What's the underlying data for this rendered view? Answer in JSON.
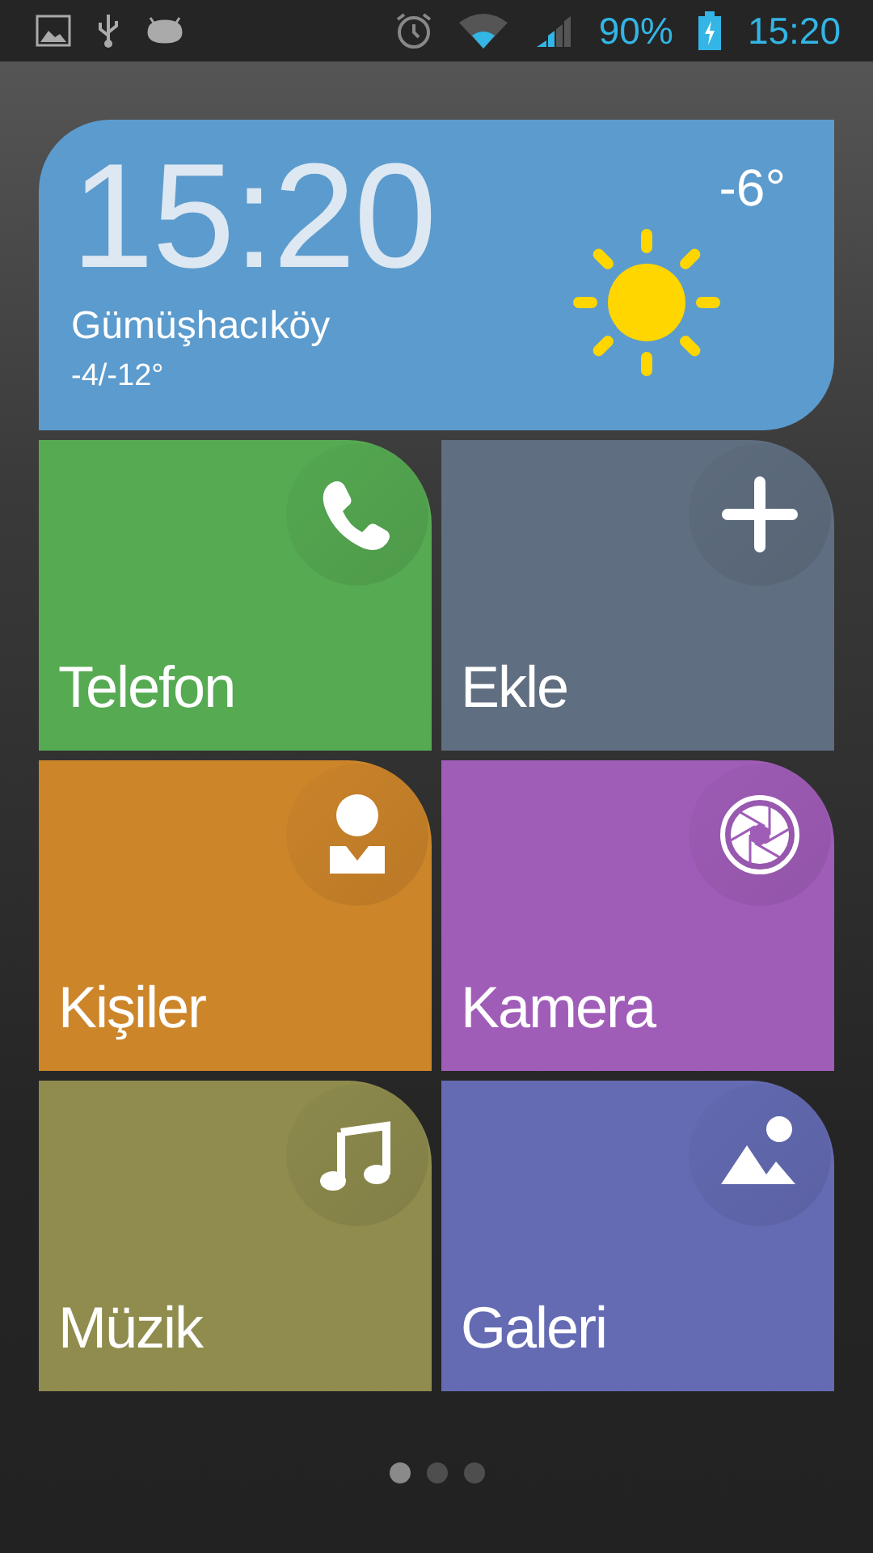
{
  "status_bar": {
    "battery": "90%",
    "time": "15:20"
  },
  "clock_widget": {
    "time": "15:20",
    "location": "Gümüşhacıköy",
    "range": "-4/-12°",
    "temperature": "-6°"
  },
  "tiles": [
    {
      "label": "Telefon",
      "kind": "phone",
      "color": "#56aa52"
    },
    {
      "label": "Ekle",
      "kind": "add",
      "color": "#5f6e80"
    },
    {
      "label": "Kişiler",
      "kind": "contacts",
      "color": "#cd852a"
    },
    {
      "label": "Kamera",
      "kind": "camera",
      "color": "#a05db8"
    },
    {
      "label": "Müzik",
      "kind": "music",
      "color": "#8f8c4e"
    },
    {
      "label": "Galeri",
      "kind": "gallery",
      "color": "#646bb3"
    }
  ],
  "pages": [
    {
      "selected": true
    },
    {
      "selected": false
    },
    {
      "selected": false
    }
  ]
}
